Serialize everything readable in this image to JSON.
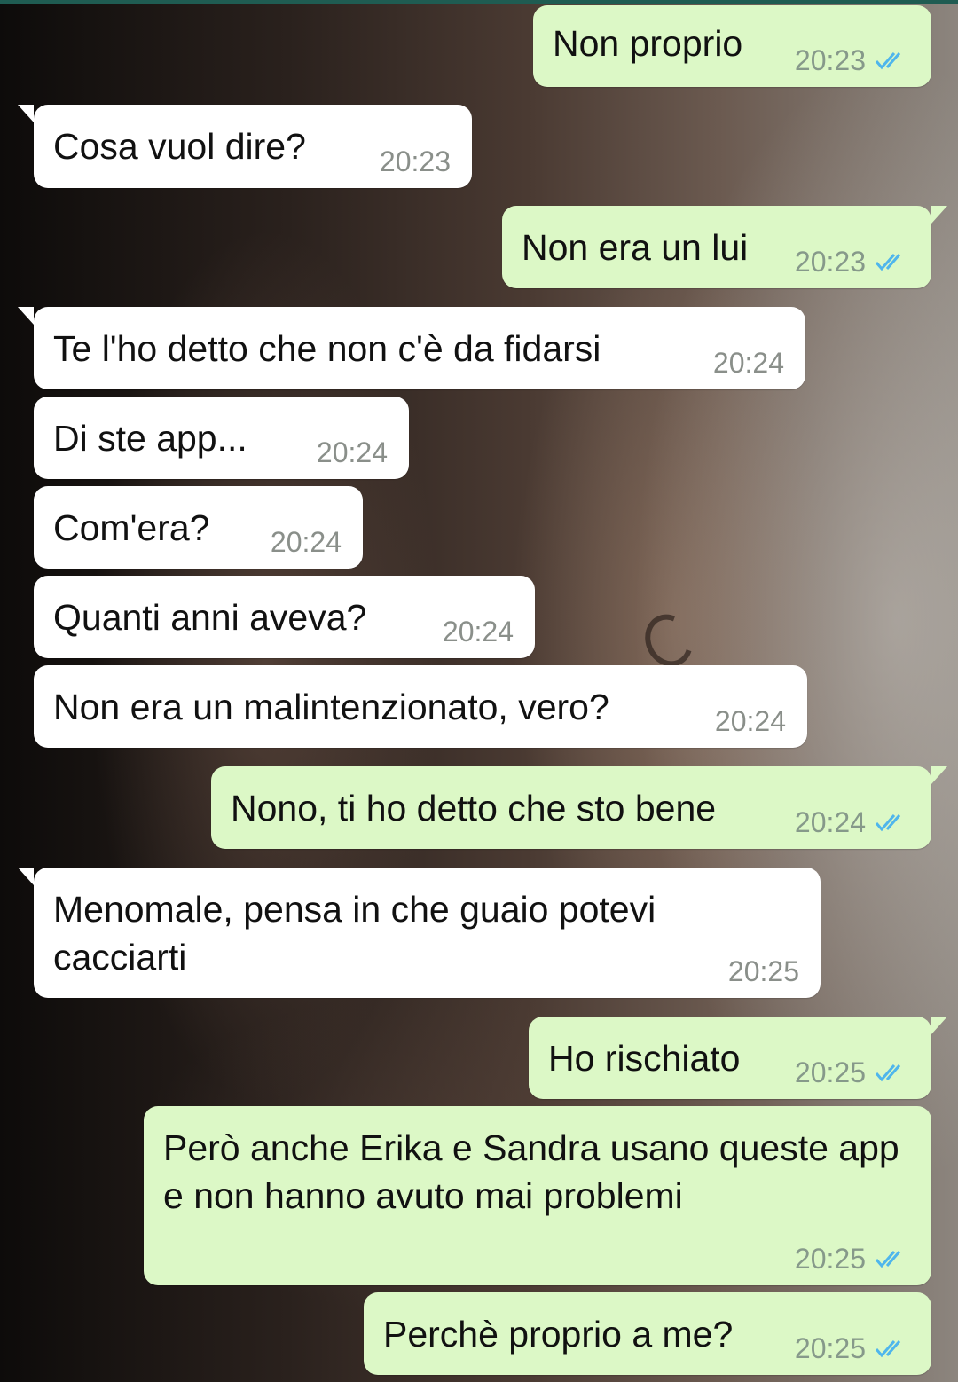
{
  "colors": {
    "incoming_bubble": "#ffffff",
    "outgoing_bubble": "#dcf8c6",
    "read_tick": "#4fb6ec",
    "timestamp": "#8a8f8a"
  },
  "icons": {
    "read_receipt": "double-check-icon"
  },
  "messages": [
    {
      "direction": "out",
      "text": "Non proprio",
      "time": "20:23",
      "status": "read"
    },
    {
      "direction": "in",
      "text": "Cosa vuol dire?",
      "time": "20:23"
    },
    {
      "direction": "out",
      "text": "Non era un lui",
      "time": "20:23",
      "status": "read"
    },
    {
      "direction": "in",
      "text": "Te l'ho detto che non c'è da fidarsi",
      "time": "20:24"
    },
    {
      "direction": "in",
      "text": "Di ste app...",
      "time": "20:24"
    },
    {
      "direction": "in",
      "text": "Com'era?",
      "time": "20:24"
    },
    {
      "direction": "in",
      "text": "Quanti anni aveva?",
      "time": "20:24"
    },
    {
      "direction": "in",
      "text": "Non era un malintenzionato, vero?",
      "time": "20:24"
    },
    {
      "direction": "out",
      "text": "Nono, ti ho detto che sto bene",
      "time": "20:24",
      "status": "read"
    },
    {
      "direction": "in",
      "text": "Menomale, pensa in che guaio potevi cacciarti",
      "time": "20:25"
    },
    {
      "direction": "out",
      "text": "Ho rischiato",
      "time": "20:25",
      "status": "read"
    },
    {
      "direction": "out",
      "text": "Però anche Erika e Sandra usano queste app e non hanno avuto mai problemi",
      "time": "20:25",
      "status": "read"
    },
    {
      "direction": "out",
      "text": "Perchè proprio a me?",
      "time": "20:25",
      "status": "read"
    }
  ]
}
